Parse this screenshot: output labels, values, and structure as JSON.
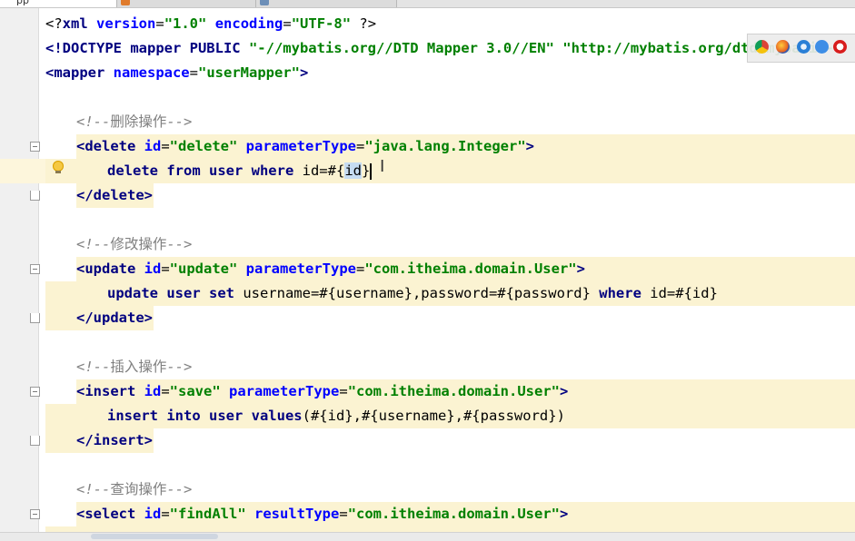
{
  "tabs": [
    {
      "label": "pp",
      "active": true
    },
    {
      "label": "",
      "active": false
    },
    {
      "label": "",
      "active": false
    }
  ],
  "code_lines": {
    "xml_decl": {
      "open": "<?",
      "name": "xml",
      "a1": "version",
      "v1": "\"1.0\"",
      "a2": "encoding",
      "v2": "\"UTF-8\"",
      "close": "?>"
    },
    "doctype": {
      "text_a": "<!DOCTYPE mapper PUBLIC ",
      "text_b": "\"-//mybatis.org//DTD Mapper 3.0//EN\"",
      "text_c": " \"http://mybatis.org/dtd/mybatis-"
    },
    "mapper_open": {
      "tag": "<mapper ",
      "attr": "namespace",
      "val": "\"userMapper\"",
      "close": ">"
    },
    "comment_delete": {
      "start": "<!--",
      "cjk": "删除操作",
      "end": "-->"
    },
    "delete_open": {
      "tag": "<delete ",
      "a1": "id",
      "v1": "\"delete\"",
      "a2": "parameterType",
      "v2": "\"java.lang.Integer\"",
      "close": ">"
    },
    "delete_body": {
      "kw": "delete from user where",
      "pre": " id=#{",
      "sel": "id",
      "post": "}"
    },
    "delete_close": {
      "tag": "</delete>"
    },
    "comment_update": {
      "start": "<!--",
      "cjk": "修改操作",
      "end": "-->"
    },
    "update_open": {
      "tag": "<update ",
      "a1": "id",
      "v1": "\"update\"",
      "a2": "parameterType",
      "v2": "\"com.itheima.domain.User\"",
      "close": ">"
    },
    "update_body": {
      "kw": "update user set",
      "mid": " username=#{username},password=#{password} ",
      "kw2": "where",
      "post": " id=#{id}"
    },
    "update_close": {
      "tag": "</update>"
    },
    "comment_insert": {
      "start": "<!--",
      "cjk": "插入操作",
      "end": "-->"
    },
    "insert_open": {
      "tag": "<insert ",
      "a1": "id",
      "v1": "\"save\"",
      "a2": "parameterType",
      "v2": "\"com.itheima.domain.User\"",
      "close": ">"
    },
    "insert_body": {
      "kw": "insert into user values",
      "post": "(#{id},#{username},#{password})"
    },
    "insert_close": {
      "tag": "</insert>"
    },
    "comment_select": {
      "start": "<!--",
      "cjk": "查询操作",
      "end": "-->"
    },
    "select_open": {
      "tag": "<select ",
      "a1": "id",
      "v1": "\"findAll\"",
      "a2": "resultType",
      "v2": "\"com.itheima.domain.User\"",
      "close": ">"
    }
  },
  "browser_icons": [
    "chrome-icon",
    "firefox-icon",
    "safari-icon",
    "ie-icon",
    "opera-icon"
  ],
  "colors": {
    "tag": "#000080",
    "attribute": "#0000ff",
    "value": "#008000",
    "comment": "#808080",
    "highlight": "#fbf3d2",
    "selection": "#c6dcf2"
  }
}
